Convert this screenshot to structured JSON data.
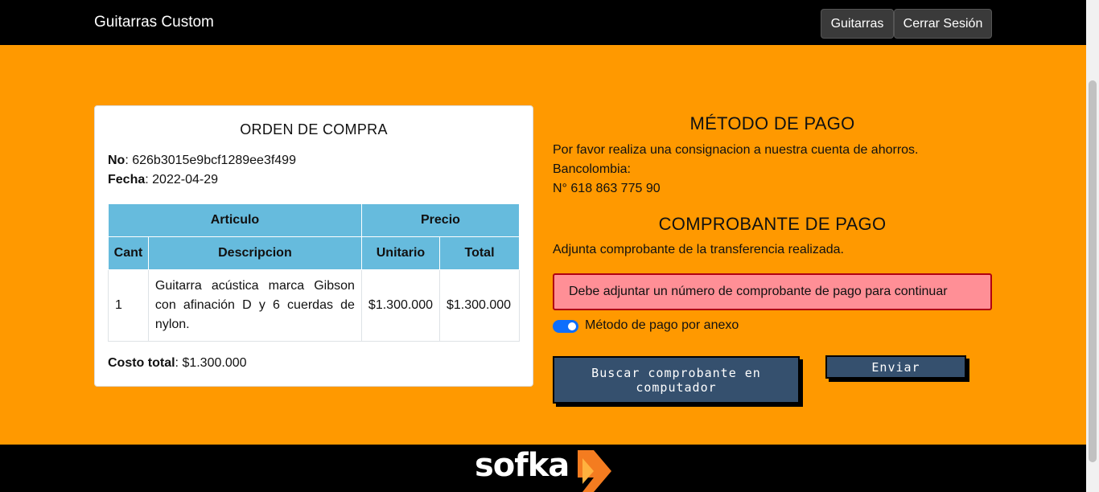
{
  "navbar": {
    "brand": "Guitarras Custom",
    "guitarras_label": "Guitarras",
    "logout_label": "Cerrar Sesión"
  },
  "order": {
    "title": "ORDEN DE COMPRA",
    "no_label": "No",
    "no_value": ": 626b3015e9bcf1289ee3f499",
    "fecha_label": "Fecha",
    "fecha_value": ": 2022-04-29",
    "table": {
      "header_articulo": "Articulo",
      "header_precio": "Precio",
      "col_cant": "Cant",
      "col_descripcion": "Descripcion",
      "col_unitario": "Unitario",
      "col_total": "Total",
      "rows": [
        {
          "cant": "1",
          "descripcion": "Guitarra acústica marca Gibson con afinación D y 6 cuerdas de nylon.",
          "unitario": "$1.300.000",
          "total": "$1.300.000"
        }
      ]
    },
    "total_label": "Costo total",
    "total_value": ": $1.300.000"
  },
  "payment": {
    "title": "MÉTODO DE PAGO",
    "line1": "Por favor realiza una consignacion a nuestra cuenta de ahorros.",
    "line2": "Bancolombia:",
    "line3": "N° 618 863 775 90",
    "receipt_title": "COMPROBANTE DE PAGO",
    "receipt_text": "Adjunta comprobante de la transferencia realizada.",
    "alert": "Debe adjuntar un número de comprobante de pago para continuar",
    "toggle_label": "Método de pago por anexo",
    "toggle_on": true,
    "browse_label": "Buscar comprobante en computador",
    "send_label": "Enviar"
  },
  "footer": {
    "logo": "sofka"
  },
  "colors": {
    "background": "#ff9900",
    "navbar": "#000000",
    "table_header": "#66bbdd",
    "alert_bg": "#ff8f96",
    "alert_border": "#b00012",
    "button": "#35506e",
    "toggle": "#0d6efd"
  }
}
